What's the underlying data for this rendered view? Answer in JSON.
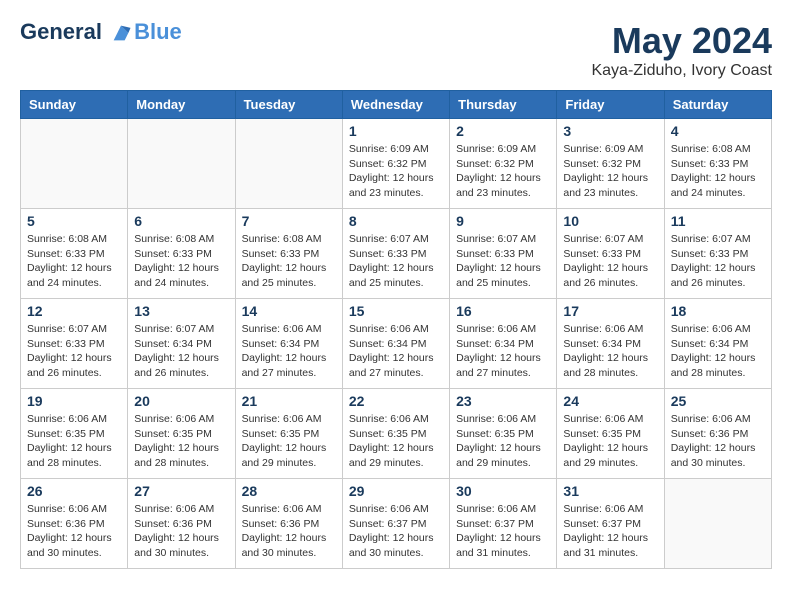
{
  "header": {
    "logo_line1": "General",
    "logo_line2": "Blue",
    "month_year": "May 2024",
    "location": "Kaya-Ziduho, Ivory Coast"
  },
  "days_of_week": [
    "Sunday",
    "Monday",
    "Tuesday",
    "Wednesday",
    "Thursday",
    "Friday",
    "Saturday"
  ],
  "weeks": [
    [
      {
        "day": "",
        "info": ""
      },
      {
        "day": "",
        "info": ""
      },
      {
        "day": "",
        "info": ""
      },
      {
        "day": "1",
        "info": "Sunrise: 6:09 AM\nSunset: 6:32 PM\nDaylight: 12 hours\nand 23 minutes."
      },
      {
        "day": "2",
        "info": "Sunrise: 6:09 AM\nSunset: 6:32 PM\nDaylight: 12 hours\nand 23 minutes."
      },
      {
        "day": "3",
        "info": "Sunrise: 6:09 AM\nSunset: 6:32 PM\nDaylight: 12 hours\nand 23 minutes."
      },
      {
        "day": "4",
        "info": "Sunrise: 6:08 AM\nSunset: 6:33 PM\nDaylight: 12 hours\nand 24 minutes."
      }
    ],
    [
      {
        "day": "5",
        "info": "Sunrise: 6:08 AM\nSunset: 6:33 PM\nDaylight: 12 hours\nand 24 minutes."
      },
      {
        "day": "6",
        "info": "Sunrise: 6:08 AM\nSunset: 6:33 PM\nDaylight: 12 hours\nand 24 minutes."
      },
      {
        "day": "7",
        "info": "Sunrise: 6:08 AM\nSunset: 6:33 PM\nDaylight: 12 hours\nand 25 minutes."
      },
      {
        "day": "8",
        "info": "Sunrise: 6:07 AM\nSunset: 6:33 PM\nDaylight: 12 hours\nand 25 minutes."
      },
      {
        "day": "9",
        "info": "Sunrise: 6:07 AM\nSunset: 6:33 PM\nDaylight: 12 hours\nand 25 minutes."
      },
      {
        "day": "10",
        "info": "Sunrise: 6:07 AM\nSunset: 6:33 PM\nDaylight: 12 hours\nand 26 minutes."
      },
      {
        "day": "11",
        "info": "Sunrise: 6:07 AM\nSunset: 6:33 PM\nDaylight: 12 hours\nand 26 minutes."
      }
    ],
    [
      {
        "day": "12",
        "info": "Sunrise: 6:07 AM\nSunset: 6:33 PM\nDaylight: 12 hours\nand 26 minutes."
      },
      {
        "day": "13",
        "info": "Sunrise: 6:07 AM\nSunset: 6:34 PM\nDaylight: 12 hours\nand 26 minutes."
      },
      {
        "day": "14",
        "info": "Sunrise: 6:06 AM\nSunset: 6:34 PM\nDaylight: 12 hours\nand 27 minutes."
      },
      {
        "day": "15",
        "info": "Sunrise: 6:06 AM\nSunset: 6:34 PM\nDaylight: 12 hours\nand 27 minutes."
      },
      {
        "day": "16",
        "info": "Sunrise: 6:06 AM\nSunset: 6:34 PM\nDaylight: 12 hours\nand 27 minutes."
      },
      {
        "day": "17",
        "info": "Sunrise: 6:06 AM\nSunset: 6:34 PM\nDaylight: 12 hours\nand 28 minutes."
      },
      {
        "day": "18",
        "info": "Sunrise: 6:06 AM\nSunset: 6:34 PM\nDaylight: 12 hours\nand 28 minutes."
      }
    ],
    [
      {
        "day": "19",
        "info": "Sunrise: 6:06 AM\nSunset: 6:35 PM\nDaylight: 12 hours\nand 28 minutes."
      },
      {
        "day": "20",
        "info": "Sunrise: 6:06 AM\nSunset: 6:35 PM\nDaylight: 12 hours\nand 28 minutes."
      },
      {
        "day": "21",
        "info": "Sunrise: 6:06 AM\nSunset: 6:35 PM\nDaylight: 12 hours\nand 29 minutes."
      },
      {
        "day": "22",
        "info": "Sunrise: 6:06 AM\nSunset: 6:35 PM\nDaylight: 12 hours\nand 29 minutes."
      },
      {
        "day": "23",
        "info": "Sunrise: 6:06 AM\nSunset: 6:35 PM\nDaylight: 12 hours\nand 29 minutes."
      },
      {
        "day": "24",
        "info": "Sunrise: 6:06 AM\nSunset: 6:35 PM\nDaylight: 12 hours\nand 29 minutes."
      },
      {
        "day": "25",
        "info": "Sunrise: 6:06 AM\nSunset: 6:36 PM\nDaylight: 12 hours\nand 30 minutes."
      }
    ],
    [
      {
        "day": "26",
        "info": "Sunrise: 6:06 AM\nSunset: 6:36 PM\nDaylight: 12 hours\nand 30 minutes."
      },
      {
        "day": "27",
        "info": "Sunrise: 6:06 AM\nSunset: 6:36 PM\nDaylight: 12 hours\nand 30 minutes."
      },
      {
        "day": "28",
        "info": "Sunrise: 6:06 AM\nSunset: 6:36 PM\nDaylight: 12 hours\nand 30 minutes."
      },
      {
        "day": "29",
        "info": "Sunrise: 6:06 AM\nSunset: 6:37 PM\nDaylight: 12 hours\nand 30 minutes."
      },
      {
        "day": "30",
        "info": "Sunrise: 6:06 AM\nSunset: 6:37 PM\nDaylight: 12 hours\nand 31 minutes."
      },
      {
        "day": "31",
        "info": "Sunrise: 6:06 AM\nSunset: 6:37 PM\nDaylight: 12 hours\nand 31 minutes."
      },
      {
        "day": "",
        "info": ""
      }
    ]
  ]
}
